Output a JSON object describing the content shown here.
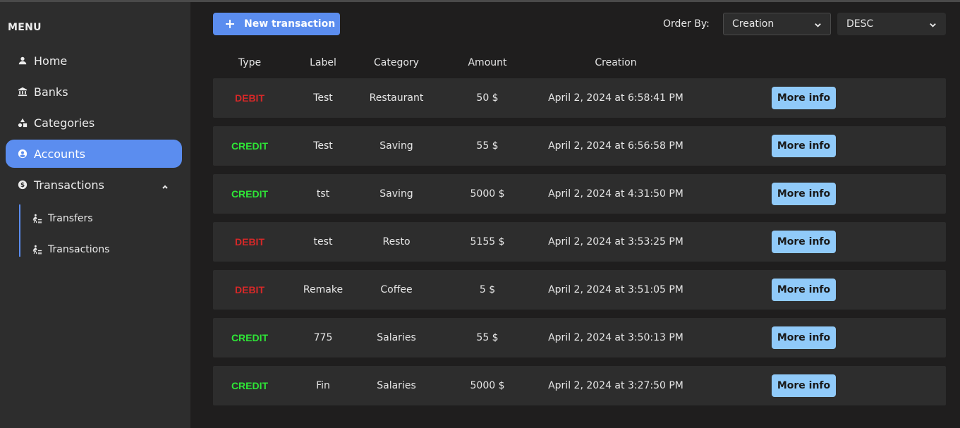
{
  "sidebar": {
    "title": "MENU",
    "items": [
      {
        "label": "Home",
        "icon": "person-icon"
      },
      {
        "label": "Banks",
        "icon": "bank-icon"
      },
      {
        "label": "Categories",
        "icon": "shapes-icon"
      },
      {
        "label": "Accounts",
        "icon": "account-circle-icon",
        "active": true
      },
      {
        "label": "Transactions",
        "icon": "dollar-circle-icon",
        "expanded": true
      }
    ],
    "subitems": [
      {
        "label": "Transfers",
        "icon": "transfer-icon"
      },
      {
        "label": "Transactions",
        "icon": "transfer-icon"
      }
    ]
  },
  "toolbar": {
    "new_label": "New transaction",
    "order_by_label": "Order By:",
    "order_by_value": "Creation",
    "direction_value": "DESC"
  },
  "table": {
    "headers": [
      "Type",
      "Label",
      "Category",
      "Amount",
      "Creation"
    ],
    "more_label": "More info",
    "rows": [
      {
        "type": "DEBIT",
        "label": "Test",
        "category": "Restaurant",
        "amount": "50 $",
        "creation": "April 2, 2024 at 6:58:41 PM"
      },
      {
        "type": "CREDIT",
        "label": "Test",
        "category": "Saving",
        "amount": "55 $",
        "creation": "April 2, 2024 at 6:56:58 PM"
      },
      {
        "type": "CREDIT",
        "label": "tst",
        "category": "Saving",
        "amount": "5000 $",
        "creation": "April 2, 2024 at 4:31:50 PM"
      },
      {
        "type": "DEBIT",
        "label": "test",
        "category": "Resto",
        "amount": "5155 $",
        "creation": "April 2, 2024 at 3:53:25 PM"
      },
      {
        "type": "DEBIT",
        "label": "Remake",
        "category": "Coffee",
        "amount": "5 $",
        "creation": "April 2, 2024 at 3:51:05 PM"
      },
      {
        "type": "CREDIT",
        "label": "775",
        "category": "Salaries",
        "amount": "55 $",
        "creation": "April 2, 2024 at 3:50:13 PM"
      },
      {
        "type": "CREDIT",
        "label": "Fin",
        "category": "Salaries",
        "amount": "5000 $",
        "creation": "April 2, 2024 at 3:27:50 PM"
      }
    ]
  },
  "colors": {
    "accent": "#5b8def",
    "debit": "#d62828",
    "credit": "#2ee637",
    "more_button": "#90caf9"
  }
}
